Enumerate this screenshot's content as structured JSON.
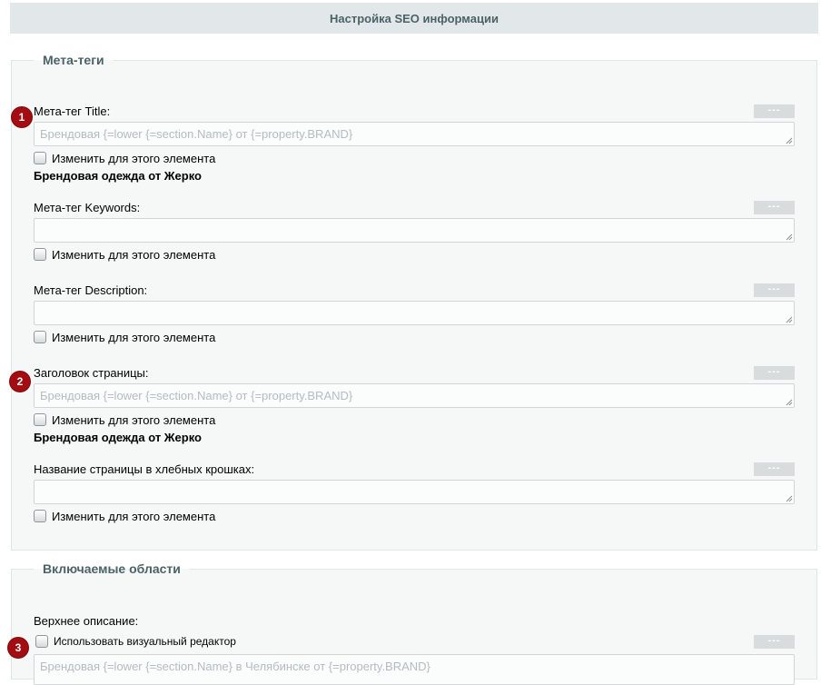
{
  "header": {
    "title": "Настройка SEO информации"
  },
  "meta_section": {
    "legend": "Мета-теги",
    "fields": [
      {
        "label": "Мета-тег Title:",
        "value": "Брендовая {=lower {=section.Name} от {=property.BRAND}",
        "checkbox": "Изменить для этого элемента",
        "preview": "Брендовая одежда от Жерко",
        "badge": "1"
      },
      {
        "label": "Мета-тег Keywords:",
        "value": "",
        "checkbox": "Изменить для этого элемента"
      },
      {
        "label": "Мета-тег Description:",
        "value": "",
        "checkbox": "Изменить для этого элемента"
      },
      {
        "label": "Заголовок страницы:",
        "value": "Брендовая {=lower {=section.Name} от {=property.BRAND}",
        "checkbox": "Изменить для этого элемента",
        "preview": "Брендовая одежда от Жерко",
        "badge": "2"
      },
      {
        "label": "Название страницы в хлебных крошках:",
        "value": "",
        "checkbox": "Изменить для этого элемента"
      }
    ]
  },
  "include_section": {
    "legend": "Включаемые области",
    "top_label": "Верхнее описание:",
    "visual_editor_checkbox": "Использовать визуальный редактор",
    "value": "Брендовая {=lower {=section.Name} в Челябинске от {=property.BRAND}",
    "badge": "3"
  },
  "dots_label": "---",
  "colors": {
    "badge": "#a30d12",
    "header_bg": "#e2e8ea",
    "section_bg": "#f6f8f8"
  }
}
